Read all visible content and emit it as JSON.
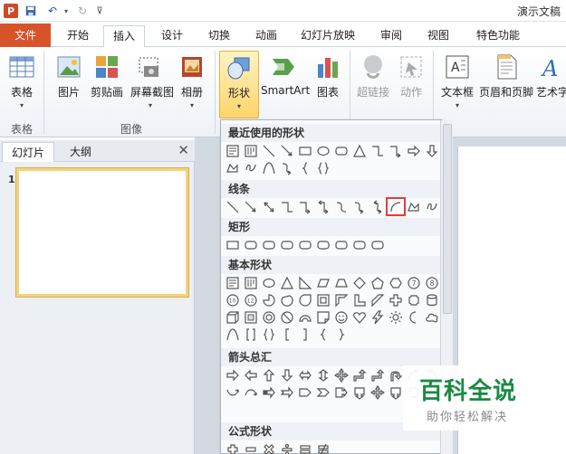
{
  "window": {
    "app_logo": "P",
    "title": "演示文稿"
  },
  "tabs": [
    "文件",
    "开始",
    "插入",
    "设计",
    "切换",
    "动画",
    "幻灯片放映",
    "审阅",
    "视图",
    "特色功能"
  ],
  "ribbon": {
    "buttons": [
      "表格",
      "图片",
      "剪贴画",
      "屏幕截图",
      "相册",
      "形状",
      "SmartArt",
      "图表",
      "超链接",
      "动作",
      "文本框",
      "页眉和页脚",
      "艺术字"
    ],
    "groups": [
      "表格",
      "图像"
    ]
  },
  "pane": {
    "tabs": [
      "幻灯片",
      "大纲"
    ],
    "close": "✕",
    "slide_number": "1"
  },
  "dropdown": {
    "sections": [
      "最近使用的形状",
      "线条",
      "矩形",
      "基本形状",
      "箭头总汇",
      "公式形状"
    ]
  },
  "watermark": {
    "title": "百科全说",
    "subtitle": "助你轻松解决"
  },
  "colors": {
    "file_tab": "#d9532a",
    "highlight": "#ffd46a",
    "selection_outline": "#e63b3b",
    "watermark": "#1a8a44"
  }
}
